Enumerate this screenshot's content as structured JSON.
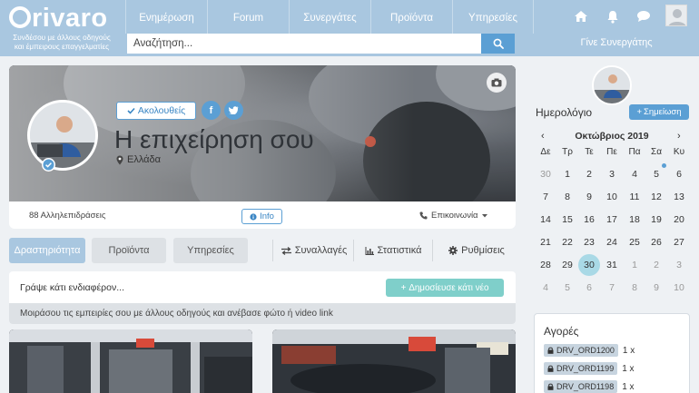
{
  "brand": {
    "logo_text": "rivaro",
    "tagline": "Συνδέσου με άλλους οδηγούς και έμπειρους επαγγελματίες"
  },
  "nav": {
    "items": [
      {
        "label": "Ενημέρωση"
      },
      {
        "label": "Forum"
      },
      {
        "label": "Συνεργάτες"
      },
      {
        "label": "Προϊόντα"
      },
      {
        "label": "Υπηρεσίες"
      }
    ]
  },
  "search": {
    "placeholder": "Αναζήτηση..."
  },
  "header_right": {
    "partner_link": "Γίνε Συνεργάτης"
  },
  "profile": {
    "follow_label": "Ακολουθείς",
    "name": "Η επιχείρηση σου",
    "location": "Ελλάδα",
    "interactions": "88 Αλληλεπιδράσεις",
    "info_label": "Info",
    "contact_label": "Επικοινωνία"
  },
  "tabs": [
    {
      "label": "Δραστηριότητα"
    },
    {
      "label": "Προϊόντα"
    },
    {
      "label": "Υπηρεσίες"
    },
    {
      "label": "Συναλλαγές"
    },
    {
      "label": "Στατιστικά"
    },
    {
      "label": "Ρυθμίσεις"
    }
  ],
  "composer": {
    "prompt": "Γράψε κάτι ενδιαφέρον...",
    "post_button": "Δημοσίευσε κάτι νέο",
    "hint": "Μοιράσου τις εμπειρίες σου με άλλους οδηγούς και ανέβασε φώτο ή video link"
  },
  "calendar": {
    "title": "Ημερολόγιο",
    "note_button": "Σημείωση",
    "month_label": "Οκτώβριος 2019",
    "prev_arrow": "‹",
    "next_arrow": "›",
    "weekdays": [
      "Δε",
      "Τρ",
      "Τε",
      "Πε",
      "Πα",
      "Σα",
      "Κυ"
    ],
    "weeks": [
      [
        "30",
        "1",
        "2",
        "3",
        "4",
        "5",
        "6"
      ],
      [
        "7",
        "8",
        "9",
        "10",
        "11",
        "12",
        "13"
      ],
      [
        "14",
        "15",
        "16",
        "17",
        "18",
        "19",
        "20"
      ],
      [
        "21",
        "22",
        "23",
        "24",
        "25",
        "26",
        "27"
      ],
      [
        "28",
        "29",
        "30",
        "31",
        "1",
        "2",
        "3"
      ],
      [
        "4",
        "5",
        "6",
        "7",
        "8",
        "9",
        "10"
      ]
    ],
    "today": "30"
  },
  "orders": {
    "title": "Αγορές",
    "items": [
      {
        "code": "DRV_ORD1200",
        "qty": "1 x"
      },
      {
        "code": "DRV_ORD1199",
        "qty": "1 x"
      },
      {
        "code": "DRV_ORD1198",
        "qty": "1 x"
      }
    ]
  },
  "colors": {
    "header_bg": "#a9c7e0",
    "accent_blue": "#5b9fd4",
    "post_button": "#7fcfca",
    "page_bg": "#eef1f4"
  }
}
